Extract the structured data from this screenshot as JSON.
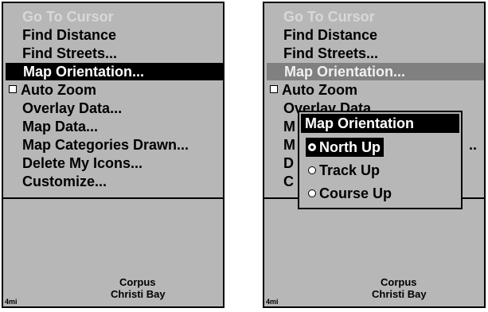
{
  "left_screen": {
    "menu_items": [
      {
        "label": "Go To Cursor",
        "state": "disabled"
      },
      {
        "label": "Find Distance",
        "state": "normal"
      },
      {
        "label": "Find Streets...",
        "state": "normal"
      },
      {
        "label": "Map Orientation...",
        "state": "selected"
      },
      {
        "label": "Auto Zoom",
        "state": "normal",
        "checkbox": true,
        "checked": false
      },
      {
        "label": "Overlay Data...",
        "state": "normal"
      },
      {
        "label": "Map Data...",
        "state": "normal"
      },
      {
        "label": "Map Categories Drawn...",
        "state": "normal"
      },
      {
        "label": "Delete My Icons...",
        "state": "normal"
      },
      {
        "label": "Customize...",
        "state": "normal"
      }
    ],
    "scale": "4mi",
    "map_label_line1": "Corpus",
    "map_label_line2": "Christi Bay"
  },
  "right_screen": {
    "menu_items": [
      {
        "label": "Go To Cursor",
        "state": "disabled"
      },
      {
        "label": "Find Distance",
        "state": "normal"
      },
      {
        "label": "Find Streets...",
        "state": "normal"
      },
      {
        "label": "Map Orientation...",
        "state": "selected-inactive"
      },
      {
        "label": "Auto Zoom",
        "state": "normal",
        "checkbox": true,
        "checked": false
      },
      {
        "label": "Overlay Data",
        "state": "normal"
      },
      {
        "label": "M",
        "state": "normal"
      },
      {
        "label": "M",
        "state": "normal",
        "trailing": ".."
      },
      {
        "label": "D",
        "state": "normal"
      },
      {
        "label": "C",
        "state": "normal"
      }
    ],
    "popup": {
      "title": "Map Orientation",
      "options": [
        {
          "label": "North Up",
          "selected": true
        },
        {
          "label": "Track Up",
          "selected": false
        },
        {
          "label": "Course Up",
          "selected": false
        }
      ]
    },
    "scale": "4mi",
    "map_label_line1": "Corpus",
    "map_label_line2": "Christi Bay"
  },
  "colors": {
    "screen_background": "#b7b7b7",
    "highlight": "#000000",
    "inactive_highlight": "#808080",
    "disabled_text": "#d8d8d8"
  }
}
